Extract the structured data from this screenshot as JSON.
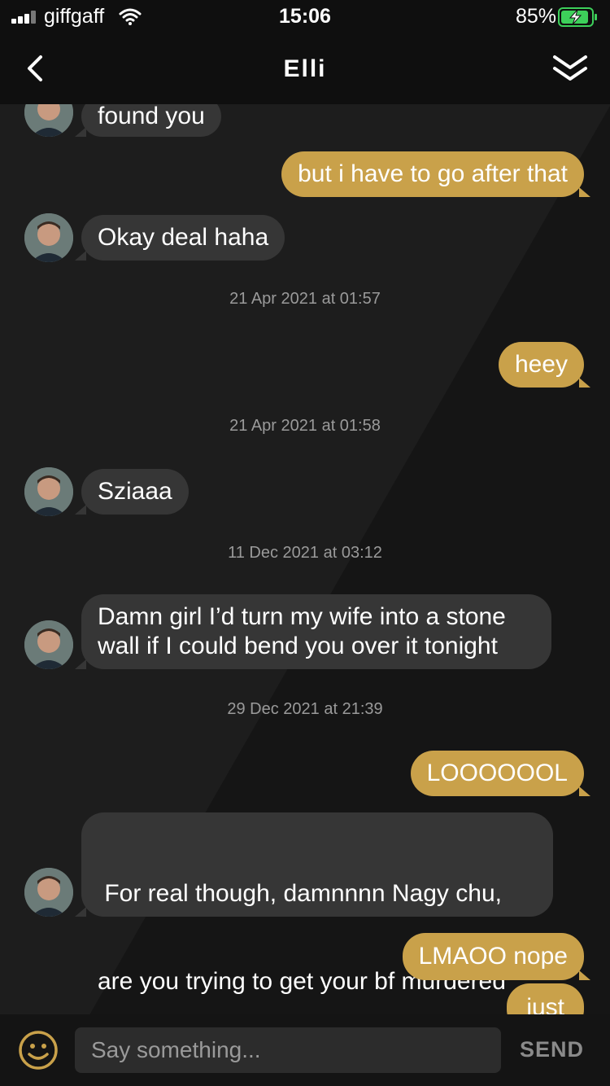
{
  "status_bar": {
    "carrier": "giffgaff",
    "time": "15:06",
    "battery": "85%"
  },
  "header": {
    "title": "Elli",
    "back_icon": "chevron-left-icon",
    "collapse_icon": "double-chevron-down-icon"
  },
  "messages": [
    {
      "from": "them",
      "text": "found you"
    },
    {
      "from": "me",
      "text": "but i have to go after that"
    },
    {
      "from": "them",
      "text": "Okay deal haha"
    },
    {
      "timestamp": "21 Apr 2021 at 01:57"
    },
    {
      "from": "me",
      "text": "heey"
    },
    {
      "timestamp": "21 Apr 2021 at 01:58"
    },
    {
      "from": "them",
      "text": "Sziaaa"
    },
    {
      "timestamp": "11 Dec 2021 at 03:12"
    },
    {
      "from": "them",
      "lines": [
        "Damn girl I’d turn my wife into a stone",
        "wall if I could bend you over it tonight"
      ]
    },
    {
      "timestamp": "29 Dec 2021 at 21:39"
    },
    {
      "from": "me",
      "text": "LOOOOOOL"
    },
    {
      "from": "them",
      "lines": [
        " For real though, damnnnn Nagy chu,",
        "are you trying to get your bf murdered",
        "😂"
      ]
    },
    {
      "from": "me",
      "text": "LMAOO nope"
    },
    {
      "from": "me",
      "text": "just"
    }
  ],
  "input_bar": {
    "emoji_icon": "smiley-icon",
    "placeholder": "Say something...",
    "send_label": "SEND"
  },
  "colors": {
    "outgoing_bubble": "#c9a14a",
    "incoming_bubble": "#363636",
    "background": "#1b1b1b"
  }
}
